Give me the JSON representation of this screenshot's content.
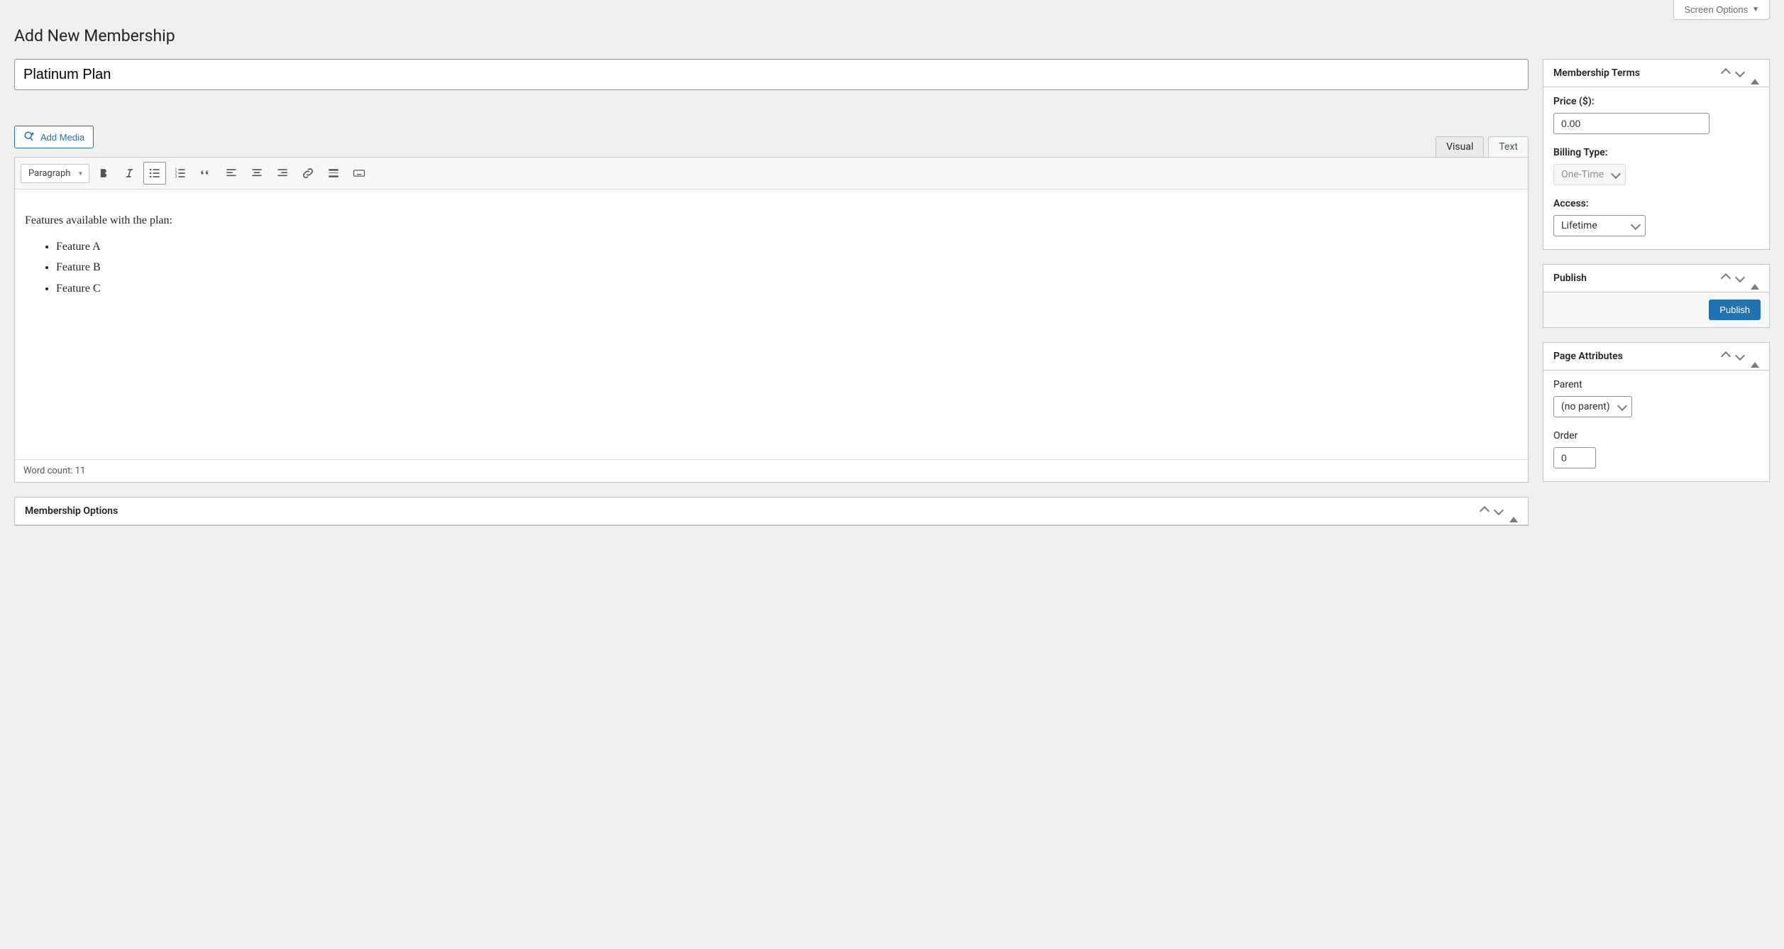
{
  "screen_options": {
    "label": "Screen Options"
  },
  "page_title": "Add New Membership",
  "title_field": {
    "value": "Platinum Plan"
  },
  "add_media": {
    "label": "Add Media"
  },
  "editor_tabs": {
    "visual": "Visual",
    "text": "Text",
    "active": "Visual"
  },
  "toolbar": {
    "paragraph_label": "Paragraph"
  },
  "content": {
    "intro": "Features available with the plan:",
    "features": [
      "Feature A",
      "Feature B",
      "Feature C"
    ]
  },
  "word_count": {
    "label": "Word count: 11"
  },
  "membership_options": {
    "title": "Membership Options"
  },
  "membership_terms": {
    "title": "Membership Terms",
    "price_label": "Price ($):",
    "price_value": "0.00",
    "billing_label": "Billing Type:",
    "billing_value": "One-Time",
    "access_label": "Access:",
    "access_value": "Lifetime"
  },
  "publish_box": {
    "title": "Publish",
    "button": "Publish"
  },
  "page_attributes": {
    "title": "Page Attributes",
    "parent_label": "Parent",
    "parent_value": "(no parent)",
    "order_label": "Order",
    "order_value": "0"
  }
}
